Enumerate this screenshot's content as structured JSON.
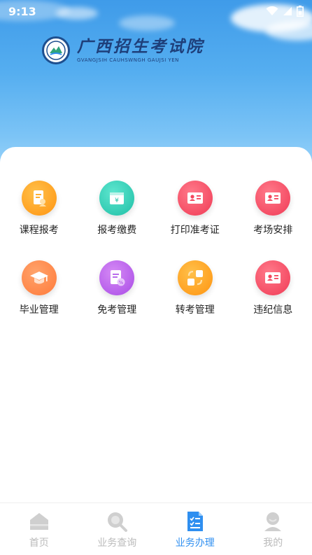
{
  "status_bar": {
    "time": "9:13"
  },
  "header": {
    "title_cn": "广西招生考试院",
    "title_en": "GVANGJSIH CAUHSWNGH GAUJSI YEN"
  },
  "colors": {
    "accent": "#2f8ff0",
    "tab_inactive": "#bbbbbb",
    "orange": "#ff9f1a",
    "teal": "#2ecbb3",
    "red": "#f4455c",
    "purple": "#b15bea"
  },
  "services": [
    {
      "label": "课程报考",
      "icon": "course-register-icon"
    },
    {
      "label": "报考缴费",
      "icon": "exam-payment-icon"
    },
    {
      "label": "打印准考证",
      "icon": "print-admission-card-icon"
    },
    {
      "label": "考场安排",
      "icon": "exam-room-arrangement-icon"
    },
    {
      "label": "毕业管理",
      "icon": "graduation-cap-icon"
    },
    {
      "label": "免考管理",
      "icon": "exemption-document-icon"
    },
    {
      "label": "转考管理",
      "icon": "transfer-exam-icon"
    },
    {
      "label": "违纪信息",
      "icon": "violation-info-icon"
    }
  ],
  "tabs": [
    {
      "label": "首页",
      "icon": "home-icon",
      "active": false
    },
    {
      "label": "业务查询",
      "icon": "search-icon",
      "active": false
    },
    {
      "label": "业务办理",
      "icon": "checklist-document-icon",
      "active": true
    },
    {
      "label": "我的",
      "icon": "user-profile-icon",
      "active": false
    }
  ]
}
